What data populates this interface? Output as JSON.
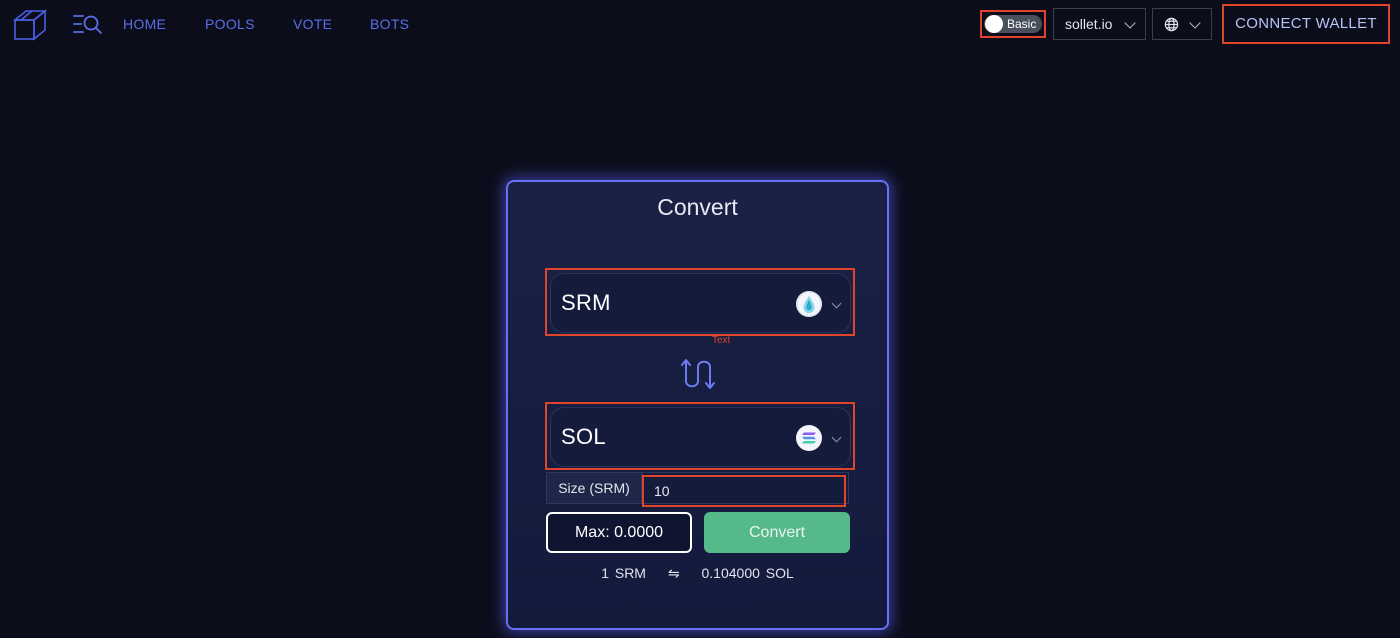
{
  "nav": {
    "links": [
      "HOME",
      "POOLS",
      "VOTE",
      "BOTS"
    ],
    "accent_color": "#5b6ee8"
  },
  "header": {
    "mode_toggle": {
      "label": "Basic",
      "on": false
    },
    "wallet_provider": "sollet.io",
    "connect_button": "CONNECT WALLET",
    "icons": [
      "cube-logo-icon",
      "menu-search-icon",
      "globe-icon",
      "chevron-down-icon"
    ]
  },
  "convert": {
    "title": "Convert",
    "from_token": {
      "symbol": "SRM",
      "icon": "srm-token-icon"
    },
    "annotation": "Text",
    "to_token": {
      "symbol": "SOL",
      "icon": "sol-token-icon"
    },
    "size_label": "Size (SRM)",
    "size_value": "10",
    "max_button": "Max: 0.0000",
    "convert_button": "Convert",
    "rate": {
      "left": "1 SRM",
      "symbol": "⇋",
      "right": "0.104000 SOL"
    }
  },
  "colors": {
    "background": "#0b0e1a",
    "card_border": "#6a6ff8",
    "highlight": "#e0442a",
    "convert_button": "#56b98a"
  }
}
